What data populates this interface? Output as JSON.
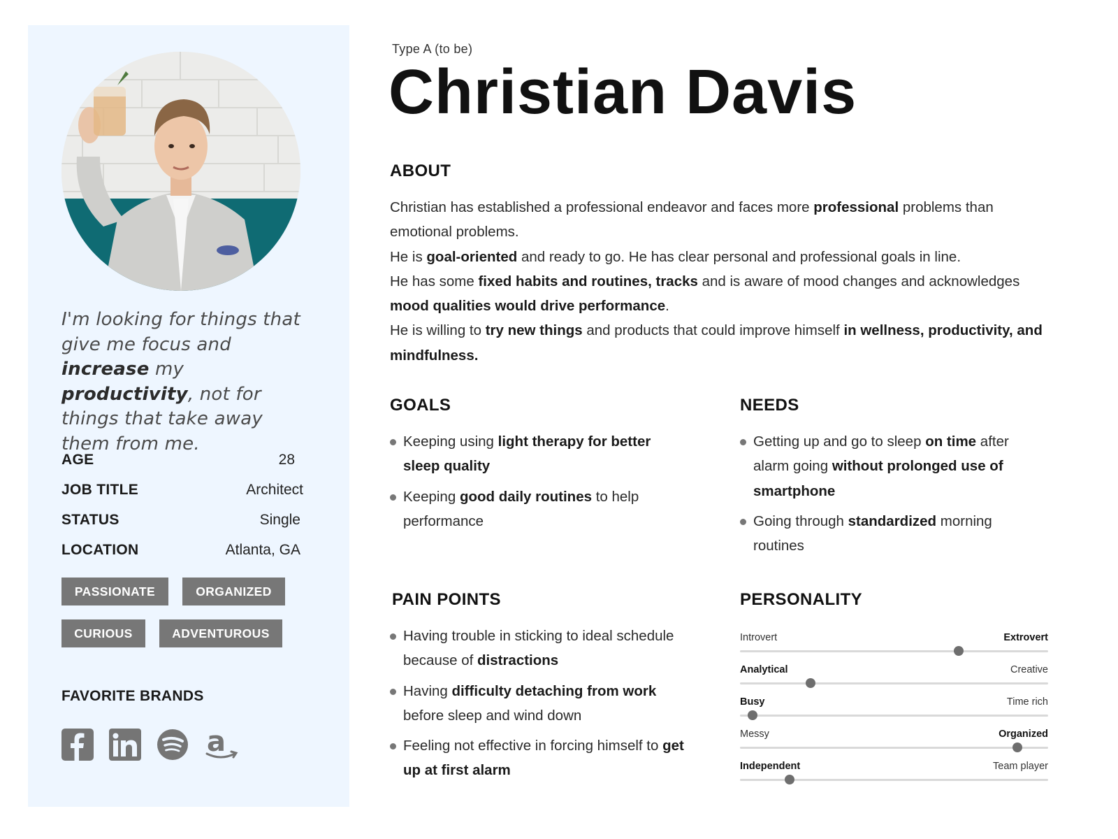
{
  "profile": {
    "type_label": "Type A (to be)",
    "name": "Christian Davis"
  },
  "quote": {
    "parts": [
      {
        "text": "I'm looking for things that give me focus and ",
        "bold": false
      },
      {
        "text": "increase",
        "bold": true
      },
      {
        "text": " my ",
        "bold": false
      },
      {
        "text": "productivity",
        "bold": true
      },
      {
        "text": ", not for things that take away them from me.",
        "bold": false
      }
    ]
  },
  "info": [
    {
      "label": "AGE",
      "value": "28"
    },
    {
      "label": "JOB TITLE",
      "value": "Architect"
    },
    {
      "label": "STATUS",
      "value": "Single"
    },
    {
      "label": "LOCATION",
      "value": "Atlanta, GA"
    }
  ],
  "tags": [
    "PASSIONATE",
    "ORGANIZED",
    "CURIOUS",
    "ADVENTUROUS"
  ],
  "brands": {
    "title": "FAVORITE BRANDS",
    "icons": [
      "facebook-icon",
      "linkedin-icon",
      "spotify-icon",
      "amazon-icon"
    ]
  },
  "about": {
    "title": "ABOUT",
    "paragraphs": [
      [
        {
          "text": "Christian has established a professional endeavor and faces more ",
          "bold": false
        },
        {
          "text": "professional",
          "bold": true
        },
        {
          "text": " problems than emotional problems.",
          "bold": false
        }
      ],
      [
        {
          "text": "He is ",
          "bold": false
        },
        {
          "text": "goal-oriented",
          "bold": true
        },
        {
          "text": " and ready to go. He has clear personal and professional goals in line.",
          "bold": false
        }
      ],
      [
        {
          "text": "He has some ",
          "bold": false
        },
        {
          "text": "fixed habits and routines, tracks",
          "bold": true
        },
        {
          "text": " and is aware of mood changes and acknowledges ",
          "bold": false
        },
        {
          "text": "mood qualities would drive performance",
          "bold": true
        },
        {
          "text": ".",
          "bold": false
        }
      ],
      [
        {
          "text": "He is willing to ",
          "bold": false
        },
        {
          "text": "try new things",
          "bold": true
        },
        {
          "text": " and products that could improve himself ",
          "bold": false
        },
        {
          "text": "in wellness, productivity, and mindfulness.",
          "bold": true
        }
      ]
    ]
  },
  "goals": {
    "title": "GOALS",
    "items": [
      [
        {
          "text": "Keeping using ",
          "bold": false
        },
        {
          "text": "light therapy for better sleep quality",
          "bold": true
        }
      ],
      [
        {
          "text": "Keeping ",
          "bold": false
        },
        {
          "text": "good daily routines",
          "bold": true
        },
        {
          "text": " to help performance",
          "bold": false
        }
      ]
    ]
  },
  "needs": {
    "title": "NEEDS",
    "items": [
      [
        {
          "text": "Getting up and go to sleep ",
          "bold": false
        },
        {
          "text": "on time",
          "bold": true
        },
        {
          "text": " after alarm going ",
          "bold": false
        },
        {
          "text": "without prolonged use of smartphone",
          "bold": true
        }
      ],
      [
        {
          "text": "Going through ",
          "bold": false
        },
        {
          "text": "standardized",
          "bold": true
        },
        {
          "text": " morning routines",
          "bold": false
        }
      ]
    ]
  },
  "pain_points": {
    "title": "PAIN POINTS",
    "items": [
      [
        {
          "text": "Having trouble in sticking to ideal schedule because of ",
          "bold": false
        },
        {
          "text": "distractions",
          "bold": true
        }
      ],
      [
        {
          "text": "Having ",
          "bold": false
        },
        {
          "text": "difficulty detaching from work",
          "bold": true
        },
        {
          "text": " before sleep and wind down",
          "bold": false
        }
      ],
      [
        {
          "text": "Feeling not effective in forcing himself to ",
          "bold": false
        },
        {
          "text": "get up at first alarm",
          "bold": true
        }
      ]
    ]
  },
  "personality": {
    "title": "PERSONALITY",
    "traits": [
      {
        "left": "Introvert",
        "right": "Extrovert",
        "value": 0.71,
        "bold": "right"
      },
      {
        "left": "Analytical",
        "right": "Creative",
        "value": 0.23,
        "bold": "left"
      },
      {
        "left": "Busy",
        "right": "Time rich",
        "value": 0.04,
        "bold": "left"
      },
      {
        "left": "Messy",
        "right": "Organized",
        "value": 0.9,
        "bold": "right"
      },
      {
        "left": "Independent",
        "right": "Team player",
        "value": 0.16,
        "bold": "left"
      }
    ]
  },
  "colors": {
    "panel_bg": "#eef6ff",
    "tag_bg": "#777777",
    "slider_knob": "#6e6e6e",
    "slider_track": "#d9d9d9"
  }
}
